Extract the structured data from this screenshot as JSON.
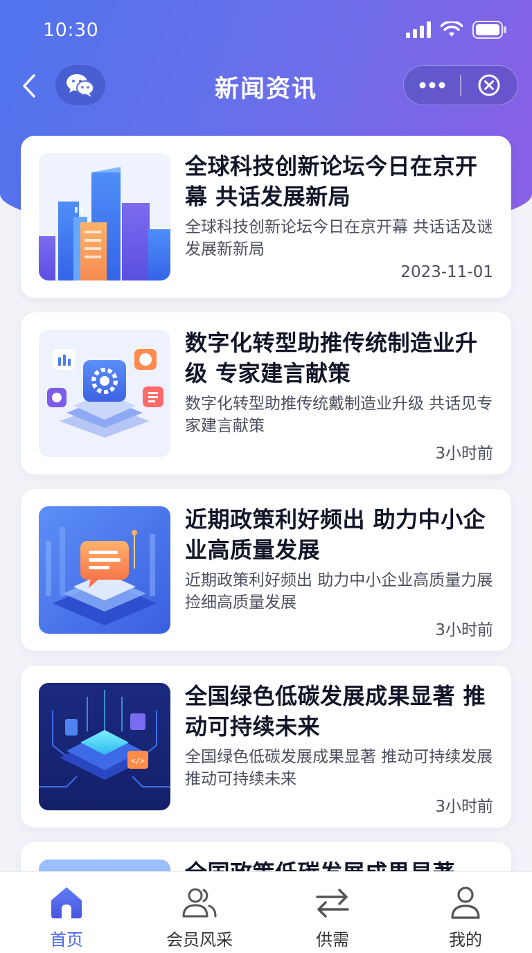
{
  "status_bar": {
    "time": "10:30"
  },
  "navbar": {
    "title": "新闻资讯",
    "icons": {
      "back": "chevron-left-icon",
      "wechat": "wechat-icon",
      "more": "more-dots-icon",
      "close": "close-circle-icon"
    }
  },
  "news": [
    {
      "title": "全球科技创新论坛今日在京开幕 共话发展新局",
      "summary": "全球科技创新论坛今日在京开幕 共话话及谜发展新新局",
      "time": "2023-11-01",
      "image": "city-buildings-illustration"
    },
    {
      "title": "数字化转型助推传统制造业升级 专家建言献策",
      "summary": "数字化转型助推传统戴制造业升级 共话见专家建言献策",
      "time": "3小时前",
      "image": "digital-gear-platform-illustration"
    },
    {
      "title": "近期政策利好频出 助力中小企业高质量发展",
      "summary": "近期政策利好频出 助力中小企业高质量力展捡细高质量发展",
      "time": "3小时前",
      "image": "chat-bubble-platform-illustration"
    },
    {
      "title": "全国绿色低碳发展成果显著 推动可持续未来",
      "summary": "全国绿色低碳发展成果显著 推动可持续发展推动可持续未来",
      "time": "3小时前",
      "image": "circuit-chip-illustration"
    },
    {
      "title": "全国政策低碳发展成果显著",
      "summary": "",
      "time": "",
      "image": "partial-illustration"
    }
  ],
  "tabbar": [
    {
      "label": "首页",
      "icon": "home-icon",
      "active": true
    },
    {
      "label": "会员风采",
      "icon": "members-icon",
      "active": false
    },
    {
      "label": "供需",
      "icon": "exchange-arrows-icon",
      "active": false
    },
    {
      "label": "我的",
      "icon": "profile-icon",
      "active": false
    }
  ],
  "colors": {
    "accent": "#4a67e8",
    "header_start": "#4f74ee",
    "header_end": "#8b5ee6"
  }
}
